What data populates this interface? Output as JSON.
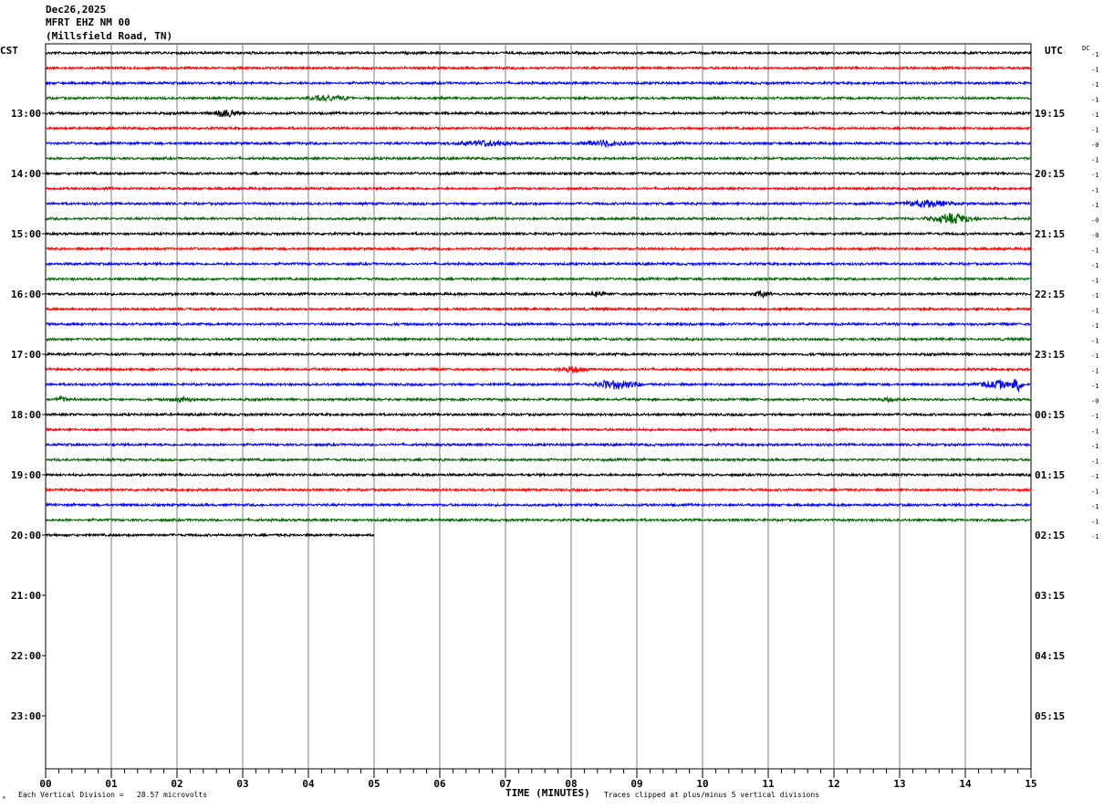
{
  "header": {
    "date": "Dec26,2025",
    "station": "MFRT EHZ NM 00",
    "location": "(Millsfield Road, TN)"
  },
  "left_tz_label": "CST",
  "right_tz_label": "UTC",
  "dc_label": "DC",
  "footer": {
    "scale_text": "Each Vertical Division =   28.57 microvolts",
    "axis_title": "TIME (MINUTES)",
    "clip_text": "Traces clipped at plus/minus 5 vertical divisions",
    "corner_mark": "ᵚ"
  },
  "colors": {
    "trace_cycle": [
      "#000000",
      "#ff0000",
      "#0000ff",
      "#006400"
    ],
    "grid": "#7f7f7f"
  },
  "chart_data": {
    "type": "line",
    "title": "MFRT EHZ NM 00",
    "xlabel": "TIME (MINUTES)",
    "xlim": [
      0,
      15
    ],
    "x_ticks": [
      "00",
      "01",
      "02",
      "03",
      "04",
      "05",
      "06",
      "07",
      "08",
      "09",
      "10",
      "11",
      "12",
      "13",
      "14",
      "15"
    ],
    "trace_minutes": 15,
    "traces_per_hour": 4,
    "left_hour_labels": [
      "13:00",
      "14:00",
      "15:00",
      "16:00",
      "17:00",
      "18:00",
      "19:00",
      "20:00",
      "21:00",
      "22:00",
      "23:00"
    ],
    "right_hour_labels": [
      "19:15",
      "20:15",
      "21:15",
      "22:15",
      "23:15",
      "00:15",
      "01:15",
      "02:15",
      "03:15",
      "04:15",
      "05:15"
    ],
    "total_rows": 32,
    "first_labeled_row": 4,
    "partial_last_row": {
      "row": 32,
      "end_minute": 5
    },
    "dc_offsets": [
      "-1",
      "-1",
      "-1",
      "-1",
      "-1",
      "-1",
      "-0",
      "-1",
      "-1",
      "-1",
      "-1",
      "-0",
      "-0",
      "-1",
      "-1",
      "-1",
      "-1",
      "-1",
      "-1",
      "-1",
      "-1",
      "-1",
      "-1",
      "-0",
      "-1",
      "-1",
      "-1",
      "-1",
      "-1",
      "-1",
      "-1",
      "-1",
      "-1"
    ],
    "events": [
      {
        "row": 3,
        "minute": 4.3,
        "amp": 3,
        "dur": 0.8
      },
      {
        "row": 4,
        "minute": 2.75,
        "amp": 4,
        "dur": 0.5
      },
      {
        "row": 6,
        "minute": 6.7,
        "amp": 3,
        "dur": 1.3
      },
      {
        "row": 6,
        "minute": 8.5,
        "amp": 3,
        "dur": 0.9
      },
      {
        "row": 10,
        "minute": 13.4,
        "amp": 4,
        "dur": 1.0
      },
      {
        "row": 11,
        "minute": 13.8,
        "amp": 5,
        "dur": 1.0
      },
      {
        "row": 16,
        "minute": 8.4,
        "amp": 3,
        "dur": 0.3
      },
      {
        "row": 16,
        "minute": 10.9,
        "amp": 3,
        "dur": 0.4
      },
      {
        "row": 21,
        "minute": 8.0,
        "amp": 3,
        "dur": 0.6
      },
      {
        "row": 22,
        "minute": 8.7,
        "amp": 5,
        "dur": 0.9
      },
      {
        "row": 22,
        "minute": 14.5,
        "amp": 4,
        "dur": 0.8
      },
      {
        "row": 22,
        "minute": 14.8,
        "amp": 6,
        "dur": 0.2
      },
      {
        "row": 23,
        "minute": 2.1,
        "amp": 3,
        "dur": 0.4
      },
      {
        "row": 23,
        "minute": 0.25,
        "amp": 3,
        "dur": 0.3
      },
      {
        "row": 23,
        "minute": 12.8,
        "amp": 2,
        "dur": 0.3
      }
    ]
  }
}
